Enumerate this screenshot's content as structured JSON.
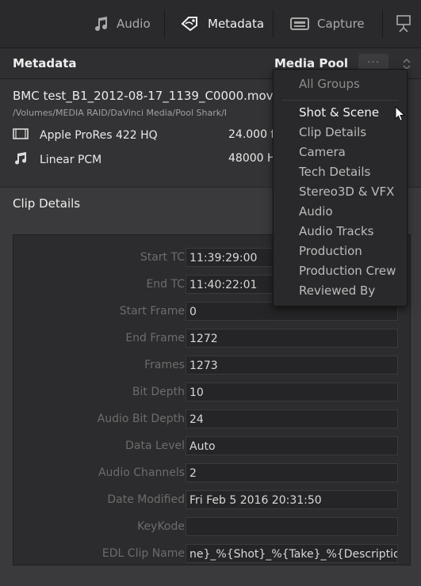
{
  "tabs": [
    {
      "label": "Audio",
      "icon": "music-note-icon"
    },
    {
      "label": "Metadata",
      "icon": "metadata-icon"
    },
    {
      "label": "Capture",
      "icon": "capture-deck-icon"
    },
    {
      "label": "",
      "icon": "inspector-icon"
    }
  ],
  "header": {
    "title": "Metadata",
    "dropdown_label": "Media Pool",
    "options_dots": "···"
  },
  "clip": {
    "filename": "BMC test_B1_2012-08-17_1139_C0000.mov",
    "path": "/Volumes/MEDIA RAID/DaVinci Media/Pool Shark/I",
    "video_codec": "Apple ProRes 422 HQ",
    "video_rate": "24.000 f",
    "audio_codec": "Linear PCM",
    "audio_rate": "48000 H"
  },
  "section_title": "Clip Details",
  "fields": [
    {
      "label": "Start TC",
      "value": "11:39:29:00"
    },
    {
      "label": "End TC",
      "value": "11:40:22:01"
    },
    {
      "label": "Start Frame",
      "value": "0"
    },
    {
      "label": "End Frame",
      "value": "1272"
    },
    {
      "label": "Frames",
      "value": "1273"
    },
    {
      "label": "Bit Depth",
      "value": "10"
    },
    {
      "label": "Audio Bit Depth",
      "value": "24"
    },
    {
      "label": "Data Level",
      "value": "Auto"
    },
    {
      "label": "Audio Channels",
      "value": "2"
    },
    {
      "label": "Date Modified",
      "value": "Fri Feb 5 2016 20:31:50"
    },
    {
      "label": "KeyKode",
      "value": ""
    },
    {
      "label": "EDL Clip Name",
      "value": "ne}_%{Shot}_%{Take}_%{Description}"
    }
  ],
  "dropdown": {
    "header": "All Groups",
    "items": [
      "Shot & Scene",
      "Clip Details",
      "Camera",
      "Tech Details",
      "Stereo3D & VFX",
      "Audio",
      "Audio Tracks",
      "Production",
      "Production Crew",
      "Reviewed By"
    ],
    "selected": "Shot & Scene"
  },
  "colors": {
    "background": "#3a3a3c",
    "panel": "#2c2c2e",
    "text": "#cfcfcf",
    "dim_label": "#6c6c6c"
  }
}
